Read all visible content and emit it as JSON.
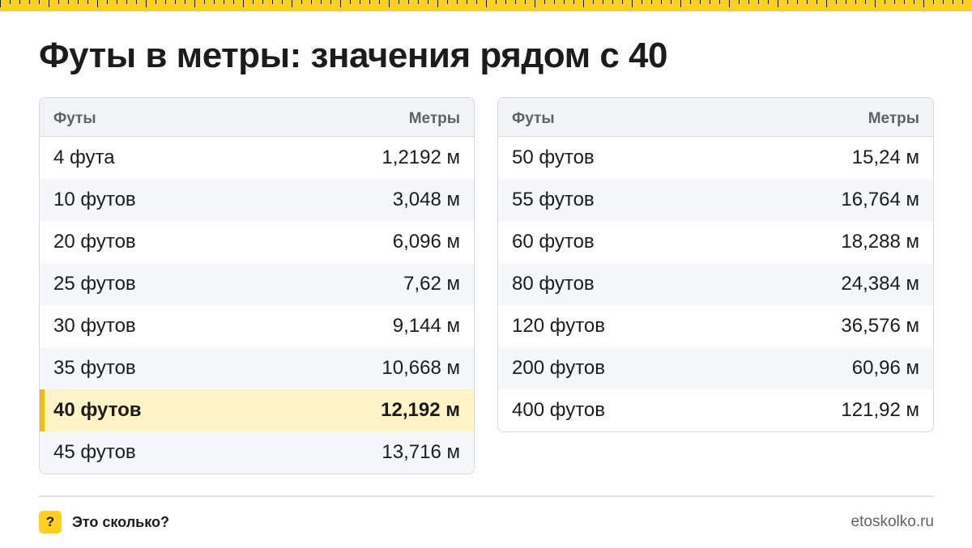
{
  "title": "Футы в метры: значения рядом с 40",
  "colors": {
    "accent": "#ffd01f",
    "highlight": "#fff4c7",
    "highlight_bar": "#f0bd0a"
  },
  "tables": [
    {
      "header": {
        "feet": "Футы",
        "meters": "Метры"
      },
      "rows": [
        {
          "feet": "4 фута",
          "meters": "1,2192 м"
        },
        {
          "feet": "10 футов",
          "meters": "3,048 м"
        },
        {
          "feet": "20 футов",
          "meters": "6,096 м"
        },
        {
          "feet": "25 футов",
          "meters": "7,62 м"
        },
        {
          "feet": "30 футов",
          "meters": "9,144 м"
        },
        {
          "feet": "35 футов",
          "meters": "10,668 м"
        },
        {
          "feet": "40 футов",
          "meters": "12,192 м",
          "highlighted": true
        },
        {
          "feet": "45 футов",
          "meters": "13,716 м"
        }
      ]
    },
    {
      "header": {
        "feet": "Футы",
        "meters": "Метры"
      },
      "rows": [
        {
          "feet": "50 футов",
          "meters": "15,24 м"
        },
        {
          "feet": "55 футов",
          "meters": "16,764 м"
        },
        {
          "feet": "60 футов",
          "meters": "18,288 м"
        },
        {
          "feet": "80 футов",
          "meters": "24,384 м"
        },
        {
          "feet": "120 футов",
          "meters": "36,576 м"
        },
        {
          "feet": "200 футов",
          "meters": "60,96 м"
        },
        {
          "feet": "400 футов",
          "meters": "121,92 м"
        }
      ]
    }
  ],
  "footer": {
    "icon": "question-icon",
    "icon_glyph": "?",
    "brand": "Это сколько?",
    "site": "etoskolko.ru"
  }
}
